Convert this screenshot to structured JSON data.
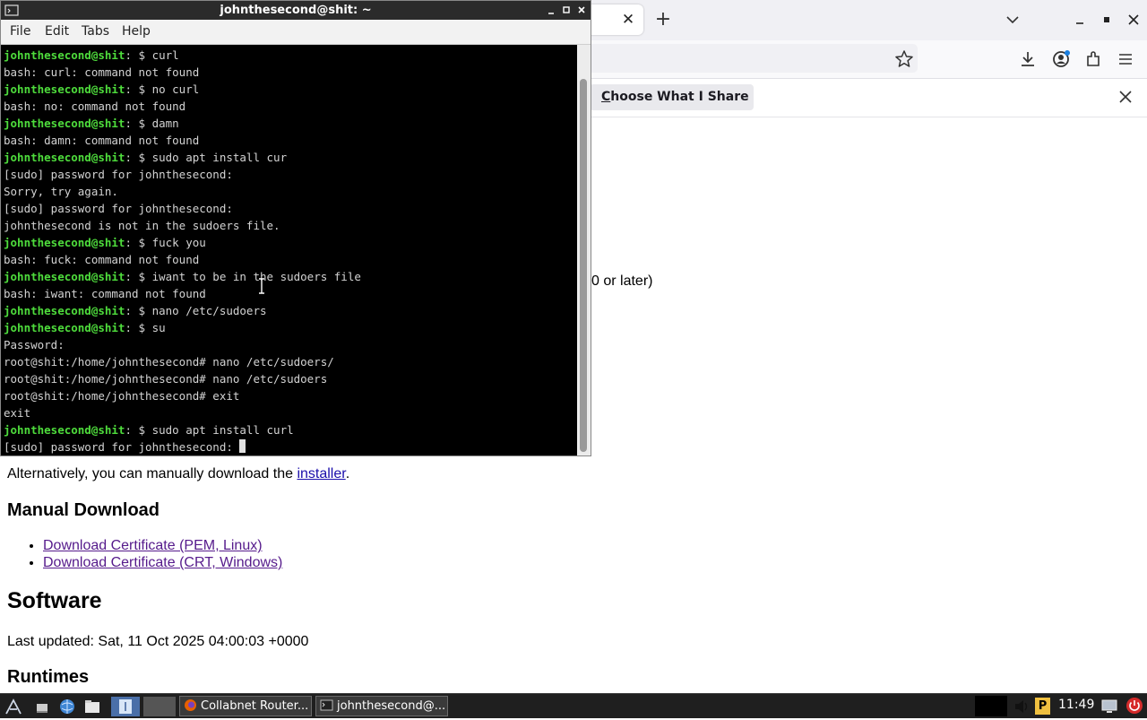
{
  "browser": {
    "tab_close_glyph": "✕",
    "new_tab_glyph": "+",
    "tab_list_glyph": "⌄",
    "notification": {
      "button_label_underlined": "C",
      "button_label_rest": "hoose What I Share"
    },
    "content": {
      "version_fragment": "0 or later)",
      "alt_text_before": "Alternatively, you can manually download the ",
      "alt_link": "installer",
      "alt_text_after": ".",
      "manual_heading": "Manual Download",
      "downloads": [
        "Download Certificate (PEM, Linux)",
        "Download Certificate (CRT, Windows)"
      ],
      "software_heading": "Software",
      "last_updated": "Last updated: Sat, 11 Oct 2025 04:00:03 +0000",
      "runtimes_heading": "Runtimes"
    }
  },
  "terminal": {
    "title": "johnthesecond@shit: ~",
    "menu": [
      "File",
      "Edit",
      "Tabs",
      "Help"
    ],
    "prompt_user": "johnthesecond@shit",
    "prompt_suffix": ": $ ",
    "lines": [
      {
        "prompt": true,
        "text": "curl"
      },
      {
        "prompt": false,
        "text": "bash: curl: command not found"
      },
      {
        "prompt": true,
        "text": "no curl"
      },
      {
        "prompt": false,
        "text": "bash: no: command not found"
      },
      {
        "prompt": true,
        "text": "damn"
      },
      {
        "prompt": false,
        "text": "bash: damn: command not found"
      },
      {
        "prompt": true,
        "text": "sudo apt install cur"
      },
      {
        "prompt": false,
        "text": "[sudo] password for johnthesecond:"
      },
      {
        "prompt": false,
        "text": "Sorry, try again."
      },
      {
        "prompt": false,
        "text": "[sudo] password for johnthesecond:"
      },
      {
        "prompt": false,
        "text": "johnthesecond is not in the sudoers file."
      },
      {
        "prompt": true,
        "text": "fuck you"
      },
      {
        "prompt": false,
        "text": "bash: fuck: command not found"
      },
      {
        "prompt": true,
        "text": "iwant to be in the sudoers file"
      },
      {
        "prompt": false,
        "text": "bash: iwant: command not found"
      },
      {
        "prompt": true,
        "text": "nano /etc/sudoers"
      },
      {
        "prompt": true,
        "text": "su"
      },
      {
        "prompt": false,
        "text": "Password:"
      },
      {
        "prompt": false,
        "text": "root@shit:/home/johnthesecond# nano /etc/sudoers/"
      },
      {
        "prompt": false,
        "text": "root@shit:/home/johnthesecond# nano /etc/sudoers"
      },
      {
        "prompt": false,
        "text": "root@shit:/home/johnthesecond# exit"
      },
      {
        "prompt": false,
        "text": "exit"
      },
      {
        "prompt": true,
        "text": "sudo apt install curl"
      },
      {
        "prompt": false,
        "text": "[sudo] password for johnthesecond: ",
        "cursor": true
      }
    ]
  },
  "taskbar": {
    "tasks": [
      {
        "label": "Collabnet Router...",
        "icon": "firefox-icon"
      },
      {
        "label": "johnthesecond@...",
        "icon": "terminal-icon"
      }
    ],
    "tray_p": "P",
    "clock": "11:49"
  },
  "colors": {
    "prompt_green": "#4edc3c",
    "terminal_bg": "#000000",
    "link_visited": "#551a8b",
    "link": "#1a0dab"
  }
}
